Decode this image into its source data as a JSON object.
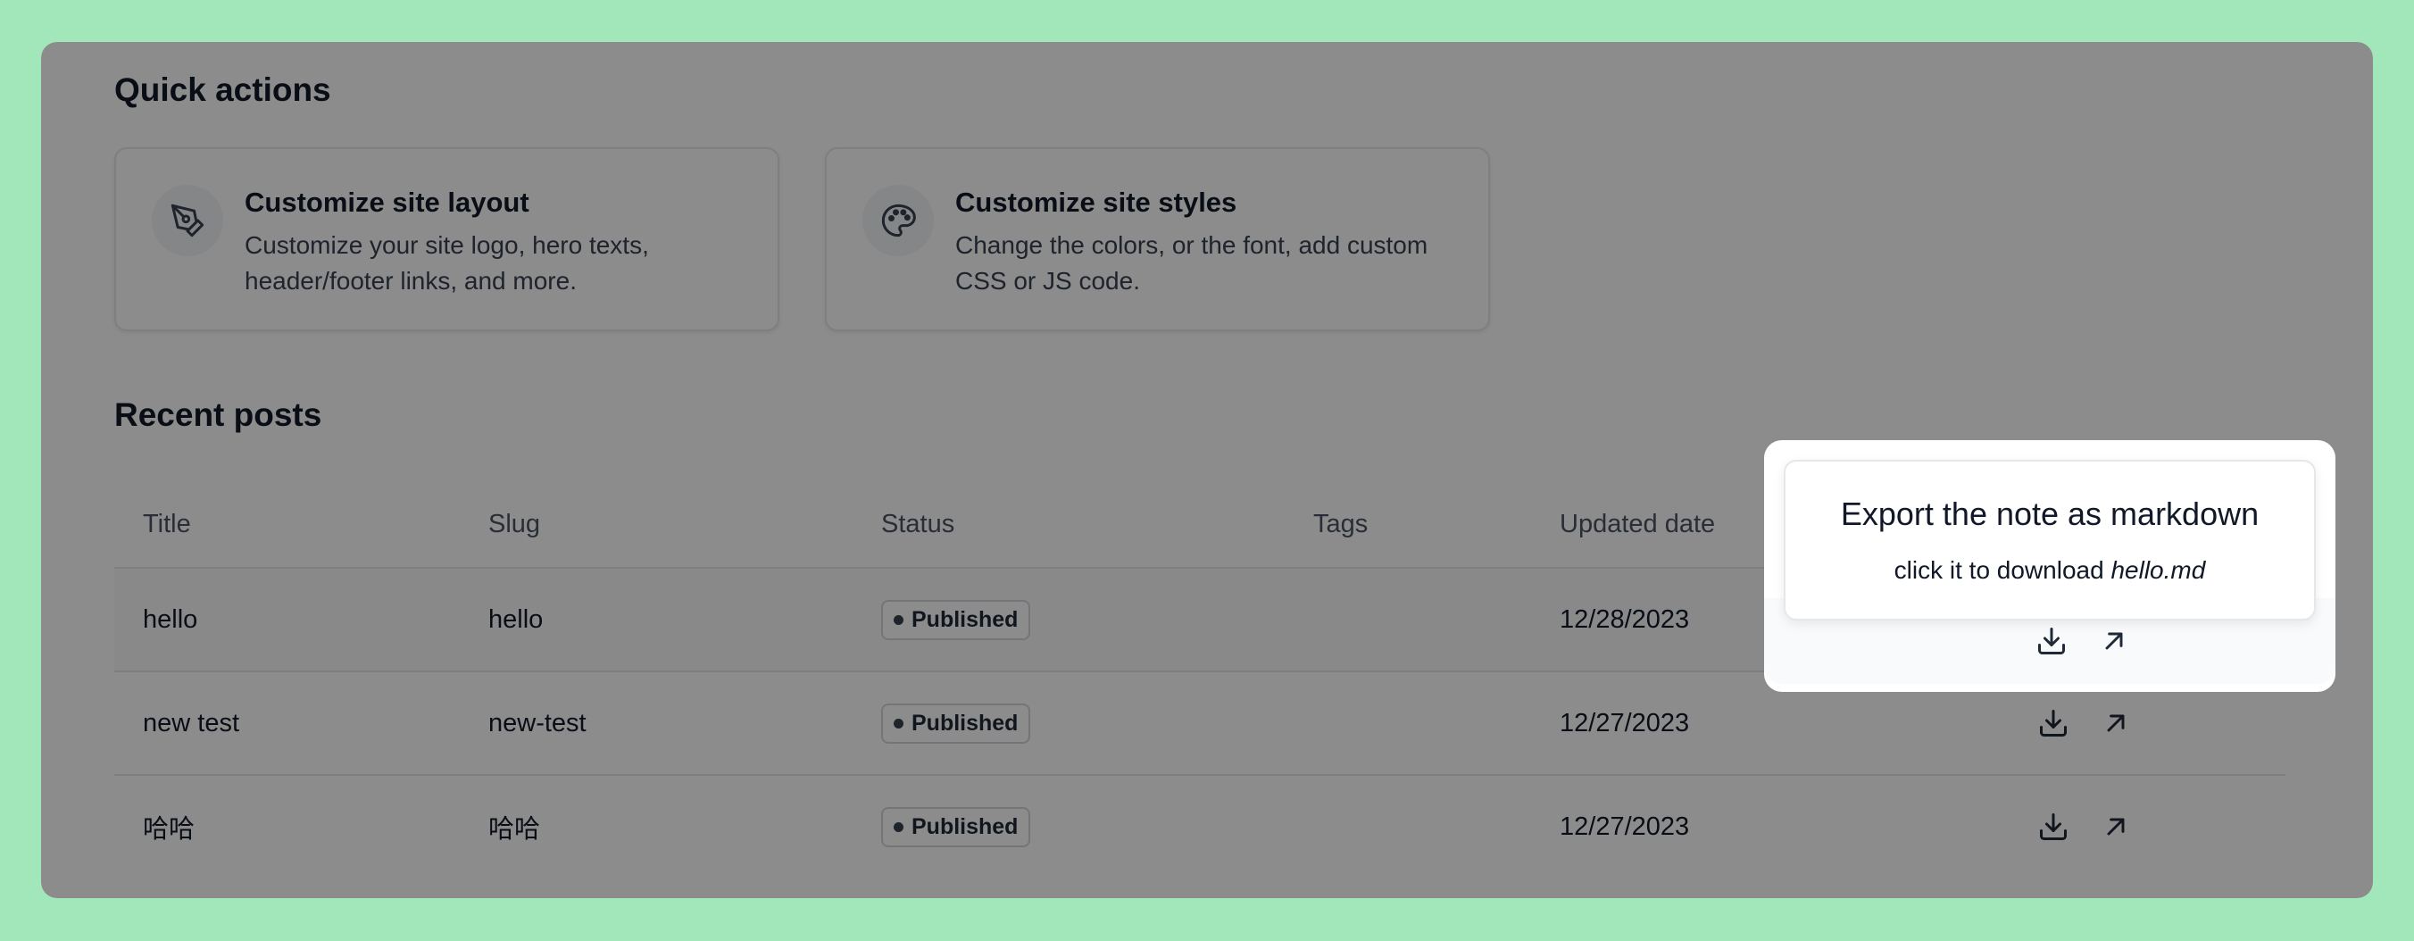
{
  "quick_actions": {
    "title": "Quick actions",
    "cards": [
      {
        "icon": "pen-tool-icon",
        "title": "Customize site layout",
        "description": "Customize your site logo, hero texts, header/footer links, and more."
      },
      {
        "icon": "palette-icon",
        "title": "Customize site styles",
        "description": "Change the colors, or the font, add custom CSS or JS code."
      }
    ]
  },
  "recent_posts": {
    "title": "Recent posts",
    "columns": [
      "Title",
      "Slug",
      "Status",
      "Tags",
      "Updated date"
    ],
    "rows": [
      {
        "title": "hello",
        "slug": "hello",
        "status": "Published",
        "tags": "",
        "updated": "12/28/2023"
      },
      {
        "title": "new test",
        "slug": "new-test",
        "status": "Published",
        "tags": "",
        "updated": "12/27/2023"
      },
      {
        "title": "哈哈",
        "slug": "哈哈",
        "status": "Published",
        "tags": "",
        "updated": "12/27/2023"
      }
    ]
  },
  "tooltip": {
    "title": "Export the note as markdown",
    "body_prefix": "click it to download",
    "filename": "hello.md"
  },
  "colors": {
    "page_background": "#a2e7b9",
    "overlay": "rgba(0,0,0,0.45)"
  }
}
